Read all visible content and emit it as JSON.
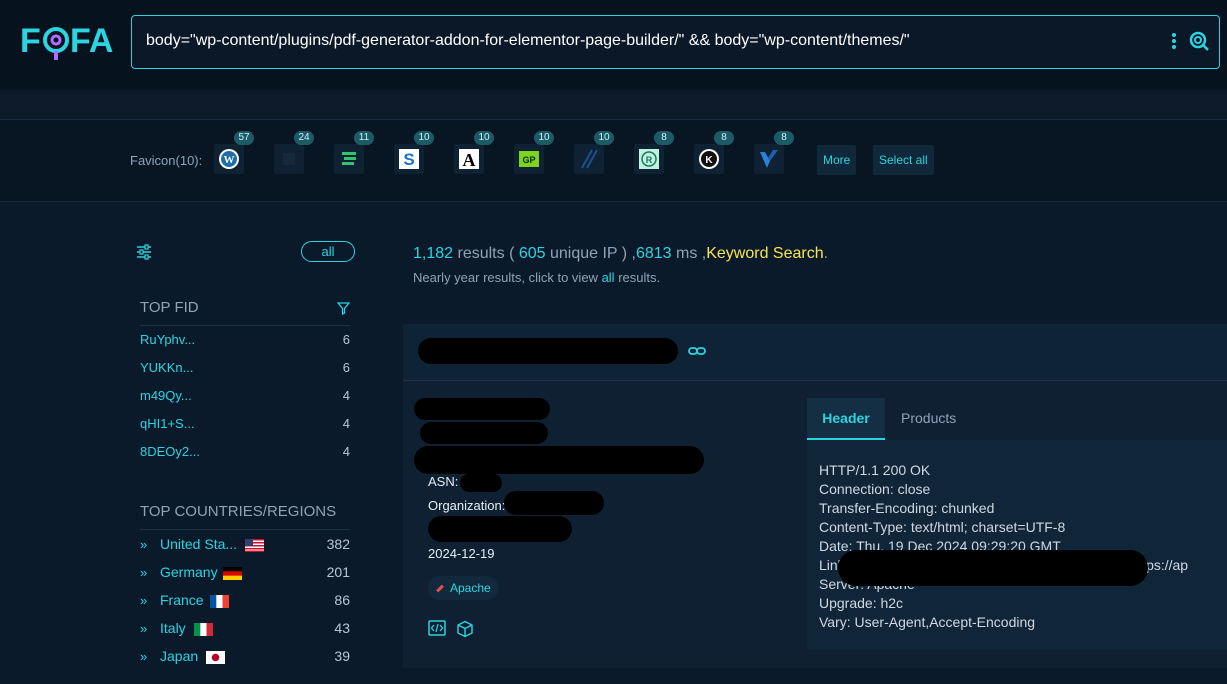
{
  "header": {
    "logo": "FOFA",
    "query": "body=\"wp-content/plugins/pdf-generator-addon-for-elementor-page-builder/\" && body=\"wp-content/themes/\""
  },
  "favicons": {
    "label": "Favicon(10):",
    "items": [
      {
        "icon": "wordpress-icon",
        "count": "57"
      },
      {
        "icon": "dark-square-icon",
        "count": "24"
      },
      {
        "icon": "green-stripes-icon",
        "count": "11"
      },
      {
        "icon": "blue-s-icon",
        "count": "10"
      },
      {
        "icon": "letter-a-icon",
        "count": "10"
      },
      {
        "icon": "gp-icon",
        "count": "10"
      },
      {
        "icon": "slash-icon",
        "count": "10"
      },
      {
        "icon": "circle-r-icon",
        "count": "8"
      },
      {
        "icon": "circle-k-icon",
        "count": "8"
      },
      {
        "icon": "blue-v-icon",
        "count": "8"
      }
    ],
    "more_label": "More",
    "select_all_label": "Select all"
  },
  "sidebar": {
    "all_label": "all",
    "top_fid": {
      "title": "TOP FID",
      "items": [
        {
          "label": "RuYphv...",
          "count": "6"
        },
        {
          "label": "YUKKn...",
          "count": "6"
        },
        {
          "label": "m49Qy...",
          "count": "4"
        },
        {
          "label": "qHI1+S...",
          "count": "4"
        },
        {
          "label": "8DEOy2...",
          "count": "4"
        }
      ]
    },
    "top_countries": {
      "title": "TOP COUNTRIES/REGIONS",
      "items": [
        {
          "label": "United Sta...",
          "count": "382",
          "flag": "us"
        },
        {
          "label": "Germany",
          "count": "201",
          "flag": "de"
        },
        {
          "label": "France",
          "count": "86",
          "flag": "fr"
        },
        {
          "label": "Italy",
          "count": "43",
          "flag": "it"
        },
        {
          "label": "Japan",
          "count": "39",
          "flag": "jp"
        }
      ]
    }
  },
  "summary": {
    "results": "1,182",
    "results_word": " results (",
    "unique_ip": " 605",
    "unique_word": " unique IP ) ,",
    "ms": "6813",
    "ms_word": " ms ,",
    "keyword": "Keyword Search",
    "period": ".",
    "note_prefix": "Nearly year results, click to view ",
    "note_link": "all",
    "note_suffix": " results."
  },
  "result": {
    "asn_label": "ASN:",
    "org_label": "Organization:",
    "date": "2024-12-19",
    "tag": "Apache",
    "tabs": {
      "header": "Header",
      "products": "Products"
    },
    "header_lines": [
      "HTTP/1.1 200 OK",
      "Connection: close",
      "Transfer-Encoding: chunked",
      "Content-Type: text/html; charset=UTF-8",
      "Date: Thu, 19 Dec 2024 09:29:20 GMT",
      "Link: <                                                              rel=\"https://ap",
      "Server: Apache",
      "Upgrade: h2c",
      "Vary: User-Agent,Accept-Encoding"
    ]
  }
}
